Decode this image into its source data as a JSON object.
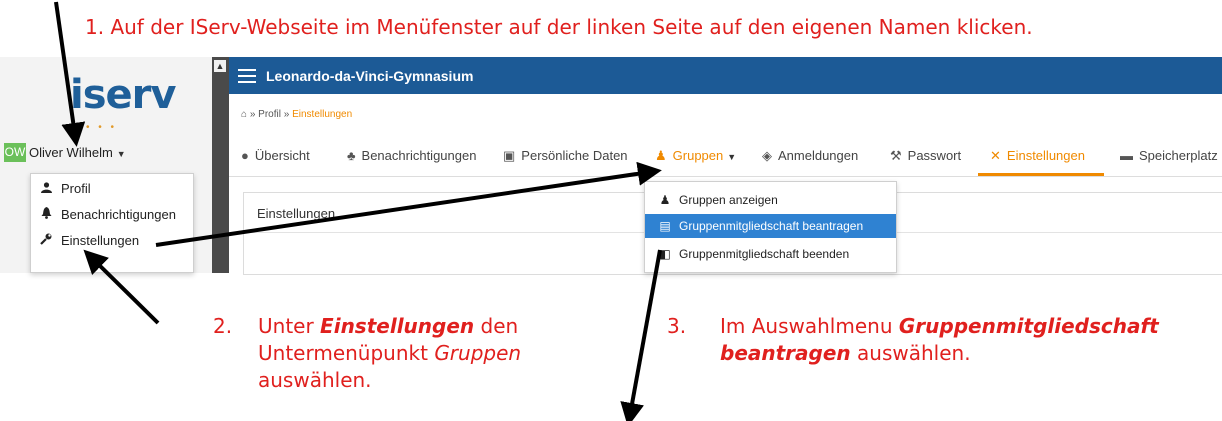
{
  "instructions": {
    "step1": "1.   Auf der IServ-Webseite im Menüfenster auf der linken Seite auf den eigenen Namen klicken.",
    "step2_num": "2.",
    "step2_a": "Unter ",
    "step2_b": "Einstellungen",
    "step2_c": " den",
    "step2_d": "Untermenüpunkt ",
    "step2_e": "Gruppen",
    "step2_f": "auswählen.",
    "step3_num": "3.",
    "step3_a": "Im Auswahlmenu ",
    "step3_b": "Gruppenmitgliedschaft",
    "step3_c": "beantragen",
    "step3_d": " auswählen."
  },
  "sidebar": {
    "logo": "iserv",
    "avatar": "OW",
    "user_name": "Oliver Wilhelm",
    "menu": [
      {
        "label": "Profil",
        "icon": "person-icon"
      },
      {
        "label": "Benachrichtigungen",
        "icon": "bell-icon"
      },
      {
        "label": "Einstellungen",
        "icon": "wrench-icon"
      }
    ]
  },
  "header": {
    "school": "Leonardo-da-Vinci-Gymnasium"
  },
  "breadcrumb": {
    "sep": "»",
    "profil": "Profil",
    "einstellungen": "Einstellungen"
  },
  "tabs": [
    {
      "label": "Übersicht",
      "icon": "person-icon"
    },
    {
      "label": "Benachrichtigungen",
      "icon": "bell-icon"
    },
    {
      "label": "Persönliche Daten",
      "icon": "id-card-icon"
    },
    {
      "label": "Gruppen",
      "icon": "group-icon"
    },
    {
      "label": "Anmeldungen",
      "icon": "eye-slash-icon"
    },
    {
      "label": "Passwort",
      "icon": "wrench-icon"
    },
    {
      "label": "Einstellungen",
      "icon": "tools-icon"
    },
    {
      "label": "Speicherplatz",
      "icon": "storage-icon"
    }
  ],
  "content": {
    "title": "Einstellungen"
  },
  "group_menu": [
    {
      "label": "Gruppen anzeigen",
      "icon": "group-icon"
    },
    {
      "label": "Gruppenmitgliedschaft beantragen",
      "icon": "clipboard-icon"
    },
    {
      "label": "Gruppenmitgliedschaft beenden",
      "icon": "door-icon"
    }
  ],
  "colors": {
    "instruction": "#e0201e",
    "topbar": "#1c5a96",
    "accent": "#f08a00",
    "selection": "#2f82d2"
  }
}
